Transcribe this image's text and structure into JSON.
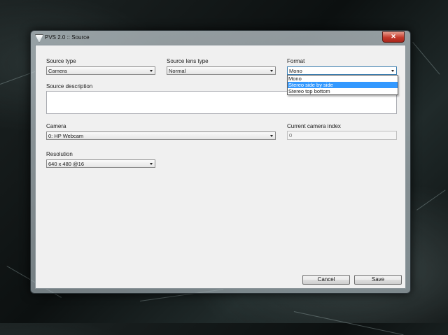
{
  "window": {
    "title": "PVS 2.0 :: Source",
    "close_glyph": "✕"
  },
  "form": {
    "source_type": {
      "label": "Source type",
      "value": "Camera"
    },
    "source_lens_type": {
      "label": "Source lens type",
      "value": "Normal"
    },
    "format": {
      "label": "Format",
      "value": "Mono",
      "options": [
        "Mono",
        "Stereo side by side",
        "Stereo top bottom"
      ],
      "highlighted": "Stereo side by side"
    },
    "source_description": {
      "label": "Source description",
      "value": ""
    },
    "camera": {
      "label": "Camera",
      "value": "0: HP Webcam"
    },
    "current_camera_index": {
      "label": "Current camera index",
      "value": "0"
    },
    "resolution": {
      "label": "Resolution",
      "value": "640 x 480 @16"
    }
  },
  "buttons": {
    "cancel": "Cancel",
    "save": "Save"
  },
  "icons": {
    "app": "pvs-app-icon",
    "dropdown": "chevron-down-icon"
  }
}
